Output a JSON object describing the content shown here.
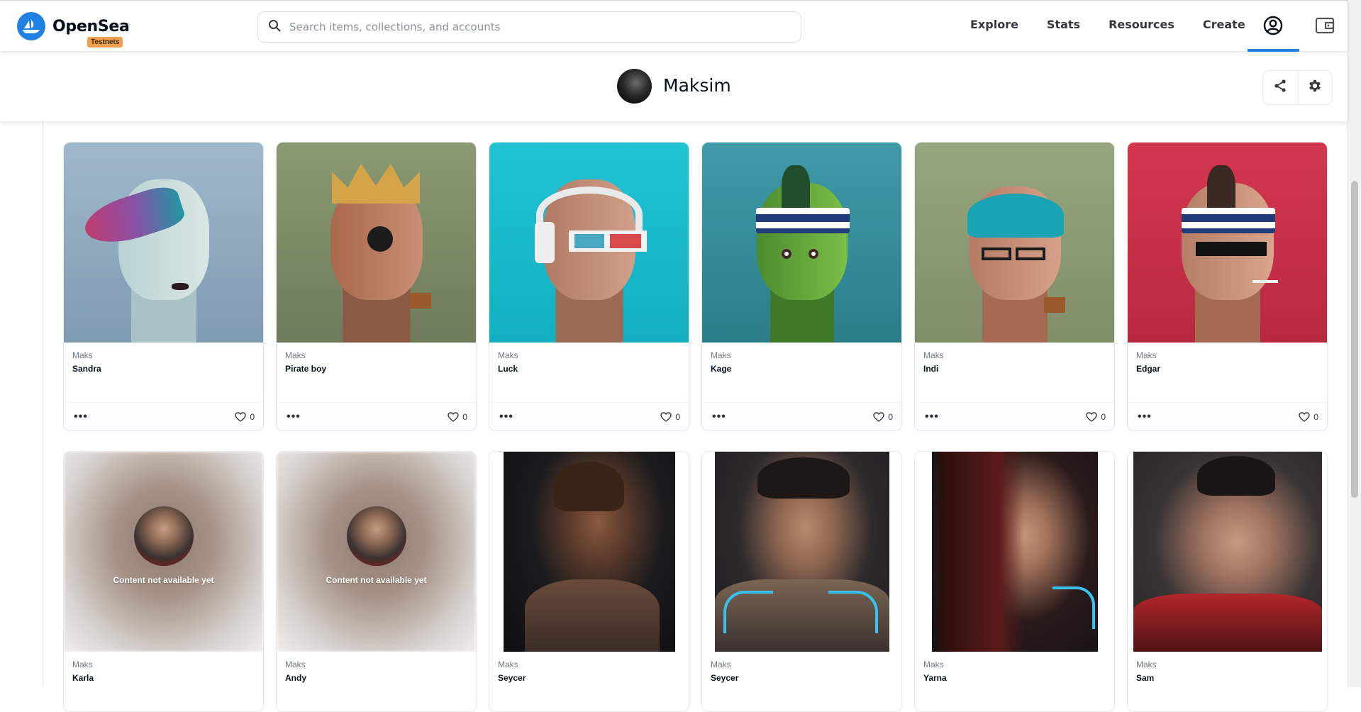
{
  "brand": {
    "name": "OpenSea",
    "badge": "Testnets",
    "accent": "#2081e2"
  },
  "search": {
    "placeholder": "Search items, collections, and accounts"
  },
  "nav": {
    "links": [
      "Explore",
      "Stats",
      "Resources",
      "Create"
    ]
  },
  "profile": {
    "name": "Maksim"
  },
  "cards": [
    {
      "collection": "Maks",
      "name": "Sandra",
      "likes": "0"
    },
    {
      "collection": "Maks",
      "name": "Pirate boy",
      "likes": "0"
    },
    {
      "collection": "Maks",
      "name": "Luck",
      "likes": "0"
    },
    {
      "collection": "Maks",
      "name": "Kage",
      "likes": "0"
    },
    {
      "collection": "Maks",
      "name": "Indi",
      "likes": "0"
    },
    {
      "collection": "Maks",
      "name": "Edgar",
      "likes": "0"
    },
    {
      "collection": "Maks",
      "name": "Karla",
      "status": "Content not available yet"
    },
    {
      "collection": "Maks",
      "name": "Andy",
      "status": "Content not available yet"
    },
    {
      "collection": "Maks",
      "name": "Seycer"
    },
    {
      "collection": "Maks",
      "name": "Seycer"
    },
    {
      "collection": "Maks",
      "name": "Yarna"
    },
    {
      "collection": "Maks",
      "name": "Sam"
    }
  ]
}
